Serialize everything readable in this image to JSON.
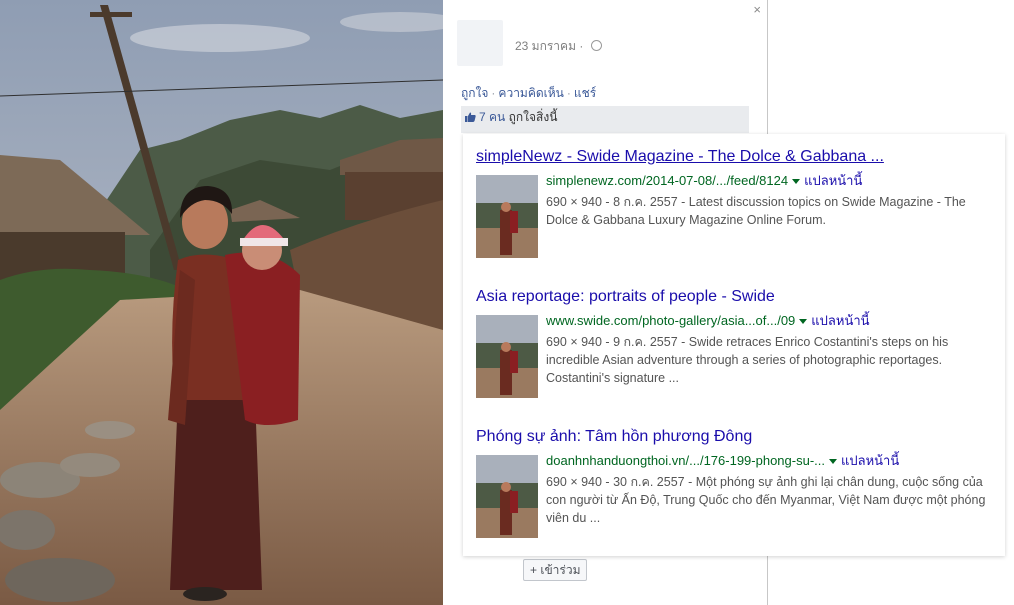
{
  "photo": {
    "alt_subject": "woman-carrying-child-on-back",
    "colors": {
      "sky": "#a9b3c2",
      "ground": "#9a7860",
      "dress": "#6a2b20"
    }
  },
  "facebook_post": {
    "close_symbol": "×",
    "date": "23 มกราคม",
    "actions": [
      "ถูกใจ",
      "ความคิดเห็น",
      "แชร์"
    ],
    "actions_separator": "·",
    "likes_count_text": "7 คน",
    "likes_suffix": "ถูกใจสิ่งนี้",
    "join_button": "+ เข้าร่วม",
    "accent_color": "#3b5998"
  },
  "search_results": [
    {
      "title": "simpleNewz - Swide Magazine - The Dolce & Gabbana ...",
      "url": "simplenewz.com/2014-07-08/.../feed/8124",
      "translate": "แปลหน้านี้",
      "snippet": "690 × 940 - 8 ก.ค. 2557 - Latest discussion topics on Swide Magazine - The Dolce & Gabbana Luxury Magazine Online Forum."
    },
    {
      "title": "Asia reportage: portraits of people - Swide",
      "url": "www.swide.com/photo-gallery/asia...of.../09",
      "translate": "แปลหน้านี้",
      "snippet": "690 × 940 - 9 ก.ค. 2557 - Swide retraces Enrico Costantini's steps on his incredible Asian adventure through a series of photographic reportages. Costantini's signature ..."
    },
    {
      "title": "Phóng sự ảnh: Tâm hồn phương Đông",
      "url": "doanhnhanduongthoi.vn/.../176-199-phong-su-...",
      "translate": "แปลหน้านี้",
      "snippet": "690 × 940 - 30 ก.ค. 2557 - Một phóng sự ảnh ghi lại chân dung, cuộc sống của con người từ Ấn Độ, Trung Quốc cho đến Myanmar, Việt Nam được một phóng viên du ..."
    }
  ],
  "colors": {
    "link": "#1a0dab",
    "url": "#006621",
    "snippet": "#545454"
  }
}
